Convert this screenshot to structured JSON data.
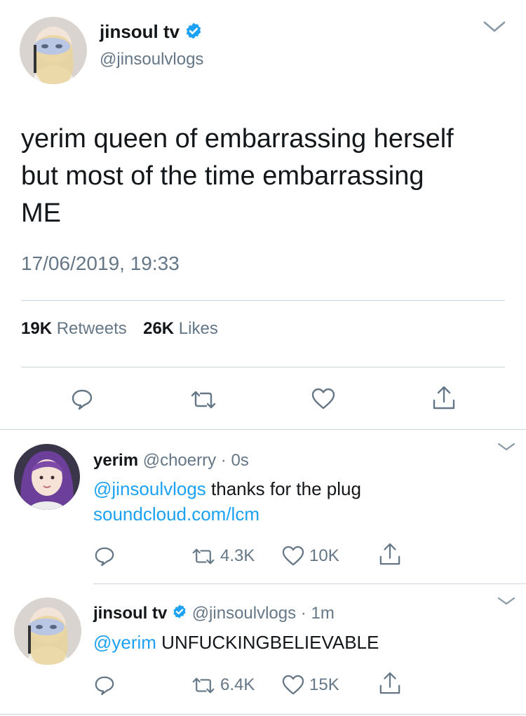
{
  "main_tweet": {
    "author_name": "jinsoul tv",
    "author_handle": "@jinsoulvlogs",
    "text_line1": "yerim queen of embarrassing herself",
    "text_line2": "but most of the time embarrassing",
    "text_line3": "ME",
    "timestamp": "17/06/2019, 19:33",
    "retweets_count": "19K",
    "retweets_label": "Retweets",
    "likes_count": "26K",
    "likes_label": "Likes",
    "icons": [
      "reply-icon",
      "retweet-icon",
      "like-icon",
      "share-icon"
    ]
  },
  "replies": [
    {
      "author_name": "yerim",
      "author_handle": "@choerry",
      "dot": "·",
      "time": "0s",
      "mention": "@jinsoulvlogs",
      "text": " thanks for the plug",
      "link": "soundcloud.com/lcm",
      "retweets": "4.3K",
      "likes": "10K"
    },
    {
      "author_name": "jinsoul tv",
      "author_handle": "@jinsoulvlogs",
      "dot": "·",
      "time": "1m",
      "mention": "@yerim",
      "text": " UNFUCKINGBELIEVABLE",
      "retweets": "6.4K",
      "likes": "15K"
    }
  ],
  "colors": {
    "verified": "#1da1f2",
    "link": "#1da1f2",
    "secondary_text": "#657786",
    "divider": "#ccd6dd"
  }
}
